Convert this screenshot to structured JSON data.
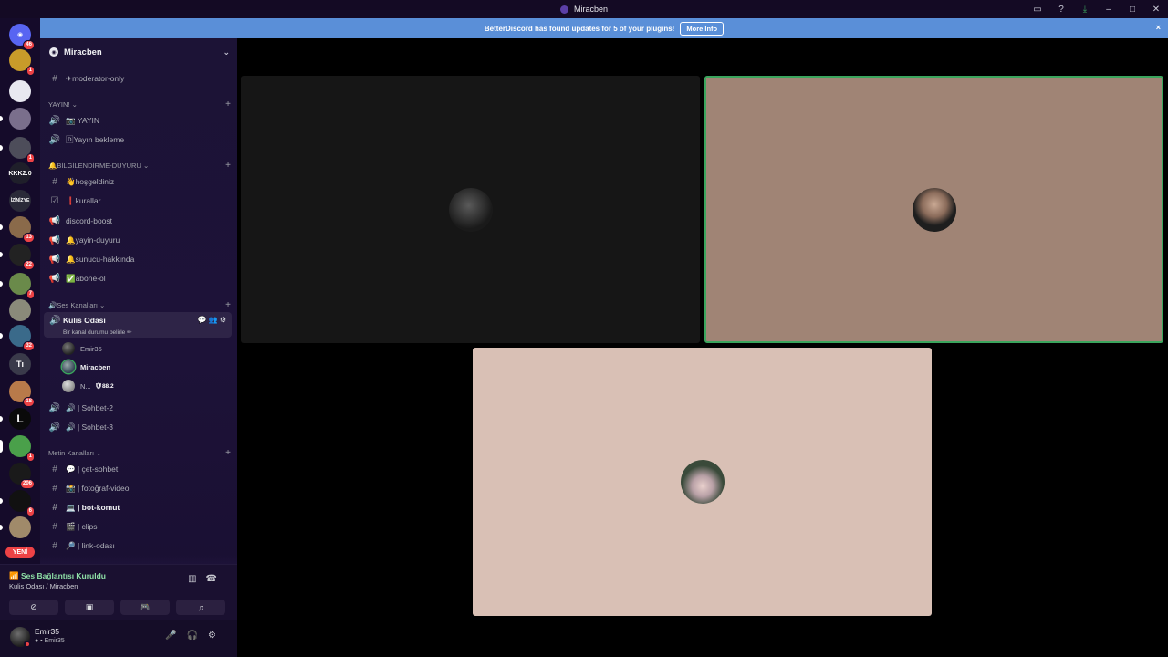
{
  "window": {
    "title": "Miracben"
  },
  "banner": {
    "text": "BetterDiscord has found updates for 5 of your plugins!",
    "button": "More Info",
    "close": "×"
  },
  "servers": {
    "home_badge": "46",
    "badges": [
      "1",
      "",
      "",
      "1",
      "",
      "",
      "13",
      "22",
      "7",
      "",
      "32",
      "",
      "18",
      "",
      "1",
      "206",
      "6",
      "",
      ""
    ],
    "text_icons": {
      "kkk": "KKK2:0",
      "izin": "İZİNİZYE",
      "ti": "Tı"
    },
    "new_label": "YENİ",
    "new_badge": "1"
  },
  "guild": {
    "name": "Miracben",
    "channels": [
      {
        "icon": "#",
        "label": "✈moderator-only"
      },
      {
        "category": "YAYIN!",
        "plus": "+"
      },
      {
        "icon": "🔊",
        "label": "📷 YAYIN"
      },
      {
        "icon": "🔊",
        "label": "🄳Yayın bekleme"
      },
      {
        "category": "🔔BİLGİLENDİRME-DUYURU",
        "plus": "+"
      },
      {
        "icon": "#",
        "label": "👋hoşgeldiniz"
      },
      {
        "icon": "☑",
        "label": "❗kurallar"
      },
      {
        "icon": "📢",
        "label": "discord-boost"
      },
      {
        "icon": "📢",
        "label": "🔔yayin-duyuru"
      },
      {
        "icon": "📢",
        "label": "🔔sunucu-hakkında"
      },
      {
        "icon": "📢",
        "label": "✅abone-ol"
      },
      {
        "category": "🔊Ses Kanalları",
        "plus": "+"
      }
    ],
    "active_voice": {
      "name": "Kulis Odası",
      "status": "Bir kanal durumu belirle ✏",
      "members": [
        {
          "name": "Emir35"
        },
        {
          "name": "Miracben"
        },
        {
          "name": "N...",
          "stream": "88.2"
        }
      ]
    },
    "more_channels": [
      {
        "icon": "🔊",
        "label": "🔊 | Sohbet-2"
      },
      {
        "icon": "🔊",
        "label": "🔊 | Sohbet-3"
      },
      {
        "category": "Metin Kanalları",
        "plus": "+"
      },
      {
        "icon": "#",
        "label": "💬 | çet-sohbet"
      },
      {
        "icon": "#",
        "label": "📸 | fotoğraf-video"
      },
      {
        "icon": "#",
        "label": "💻 | bot-komut"
      },
      {
        "icon": "#",
        "label": "🎬 | clips"
      },
      {
        "icon": "#",
        "label": "🔎 | link-odası"
      }
    ]
  },
  "voice_panel": {
    "status": "Ses Bağlantısı Kuruldu",
    "location": "Kulis Odası / Miracben"
  },
  "user": {
    "name": "Emir35",
    "tag": "Emir35"
  },
  "colors": {
    "speaking_border": "#3ba55d",
    "banner": "#5a8fd8",
    "badge": "#ed4245"
  }
}
